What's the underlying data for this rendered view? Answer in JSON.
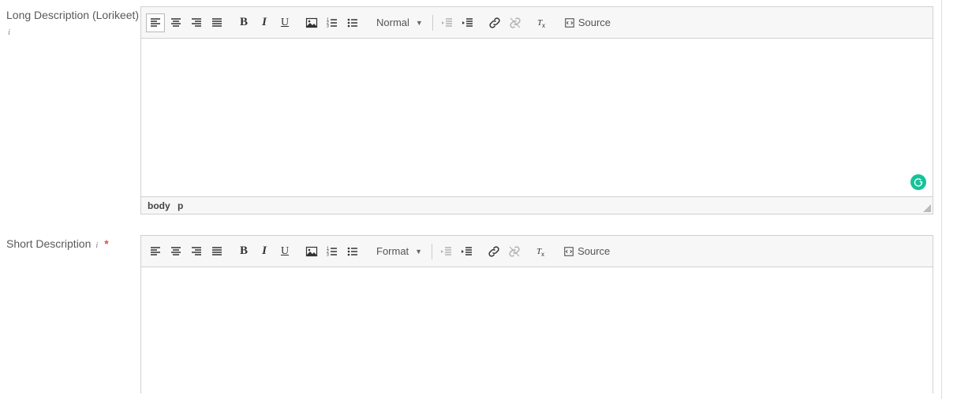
{
  "fields": {
    "long_desc": {
      "label": "Long Description (Lorikeet)"
    },
    "short_desc": {
      "label": "Short Description",
      "required": true
    }
  },
  "toolbar": {
    "format_long": "Normal",
    "format_short": "Format",
    "source_label": "Source",
    "bold_glyph": "B",
    "italic_glyph": "I",
    "underline_glyph": "U"
  },
  "status": {
    "path_body": "body",
    "path_p": "p"
  }
}
